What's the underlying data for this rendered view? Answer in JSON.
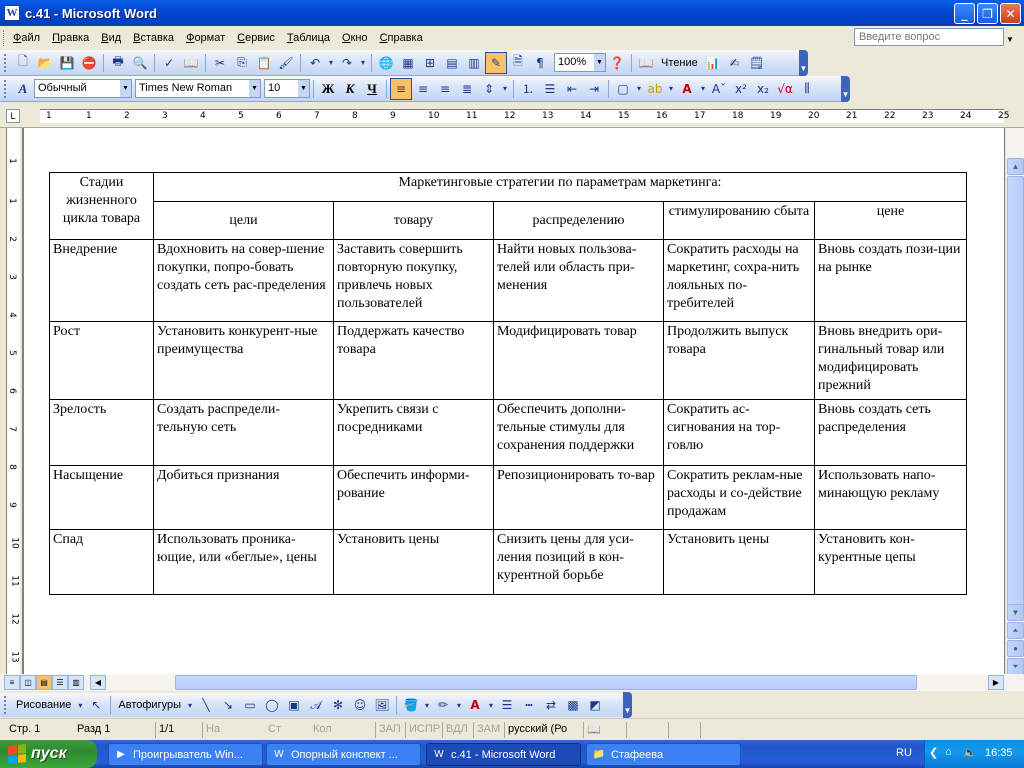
{
  "window": {
    "title": "c.41 - Microsoft Word"
  },
  "menu": [
    "Файл",
    "Правка",
    "Вид",
    "Вставка",
    "Формат",
    "Сервис",
    "Таблица",
    "Окно",
    "Справка"
  ],
  "ask": {
    "placeholder": "Введите вопрос"
  },
  "toolbar": {
    "zoom": "100%",
    "reading": "Чтение",
    "style": "Обычный",
    "font": "Times New Roman",
    "size": "10"
  },
  "ruler": {
    "h_labels": [
      "1",
      "1",
      "2",
      "3",
      "4",
      "5",
      "6",
      "7",
      "8",
      "9",
      "10",
      "11",
      "12",
      "13",
      "14",
      "15",
      "16",
      "17",
      "18",
      "19",
      "20",
      "21",
      "22",
      "23",
      "24",
      "25"
    ],
    "v_labels": [
      "1",
      "1",
      "2",
      "3",
      "4",
      "5",
      "6",
      "7",
      "8",
      "9",
      "10",
      "11",
      "12",
      "13"
    ]
  },
  "table": {
    "stage_header": "Стадии жизненного цикла товара",
    "strategies_header": "Маркетинговые стратегии по параметрам маркетинга:",
    "sub_headers": [
      "цели",
      "товару",
      "распределению",
      "стимулированию сбыта",
      "цене"
    ],
    "rows": [
      {
        "stage": "Внедрение",
        "cells": [
          "Вдохновить на совер-шение покупки, попро-бовать создать сеть рас-пределения",
          "Заставить совершить повторную покупку, привлечь новых пользователей",
          "Найти новых пользова-телей или область при-менения",
          "Сократить расходы на маркетинг, сохра-нить лояльных по-требителей",
          "Вновь создать пози-ции на рынке"
        ]
      },
      {
        "stage": "Рост",
        "cells": [
          "Установить конкурент-ные преимущества",
          "Поддержать качество товара",
          "Модифицировать товар",
          "Продолжить выпуск товара",
          "Вновь внедрить ори-гинальный товар или модифицировать прежний"
        ]
      },
      {
        "stage": "Зрелость",
        "cells": [
          "Создать распредели-тельную сеть",
          "Укрепить связи с посредниками",
          "Обеспечить дополни-тельные стимулы для сохранения поддержки",
          "Сократить ас-сигнования на тор-говлю",
          "Вновь создать сеть распределения"
        ]
      },
      {
        "stage": "Насыщение",
        "cells": [
          "Добиться признания",
          "Обеспечить информи-рование",
          "Репозиционировать то-вар",
          "Сократить реклам-ные расходы и со-действие продажам",
          "Использовать напо-минающую рекламу"
        ]
      },
      {
        "stage": "Спад",
        "cells": [
          "Использовать проника-ющие, или «беглые», цены",
          "Установить цены",
          "Снизить цены для уси-ления позиций в кон-курентной борьбе",
          "Установить цены",
          "Установить кон-курентные цепы"
        ]
      }
    ]
  },
  "drawbar": {
    "drawing": "Рисование",
    "autoshapes": "Автофигуры"
  },
  "status": {
    "page": "Стр. 1",
    "section": "Разд 1",
    "pages": "1/1",
    "at": "На",
    "ln": "Ст",
    "col": "Кол",
    "rec": "ЗАП",
    "trk": "ИСПР",
    "ext": "ВДЛ",
    "ovr": "ЗАМ",
    "lang": "русский (Ро"
  },
  "taskbar": {
    "start": "пуск",
    "tasks": [
      "Проигрыватель Win...",
      "Опорный конспект ...",
      "c.41 - Microsoft Word",
      "Стафеева"
    ],
    "lang": "RU",
    "clock": "16:35"
  }
}
